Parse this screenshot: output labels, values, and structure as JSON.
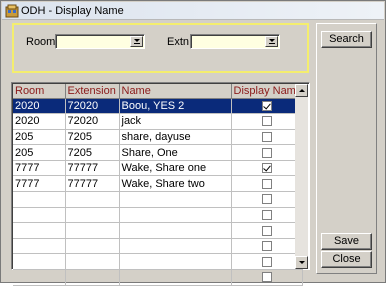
{
  "window": {
    "title": "ODH - Display Name"
  },
  "filters": {
    "room_label": "Room",
    "room_value": "",
    "extn_label": "Extn.",
    "extn_value": ""
  },
  "buttons": {
    "search": "Search",
    "save": "Save",
    "close": "Close"
  },
  "grid": {
    "columns": [
      "Room",
      "Extension",
      "Name",
      "Display Name"
    ],
    "rows": [
      {
        "room": "2020",
        "extension": "72020",
        "name": "Boou, YES 2",
        "display": true,
        "selected": true
      },
      {
        "room": "2020",
        "extension": "72020",
        "name": "jack",
        "display": false,
        "selected": false
      },
      {
        "room": "205",
        "extension": "7205",
        "name": "share, dayuse",
        "display": false,
        "selected": false
      },
      {
        "room": "205",
        "extension": "7205",
        "name": "Share, One",
        "display": false,
        "selected": false
      },
      {
        "room": "7777",
        "extension": "77777",
        "name": "Wake, Share one",
        "display": true,
        "selected": false
      },
      {
        "room": "7777",
        "extension": "77777",
        "name": "Wake, Share two",
        "display": false,
        "selected": false
      }
    ],
    "empty_rows": 6
  },
  "colors": {
    "header_text": "#8b1a1a",
    "selected_row": "#0a2a7a",
    "filter_border": "#f4ee6e",
    "input_bg": "#ffffe1"
  }
}
